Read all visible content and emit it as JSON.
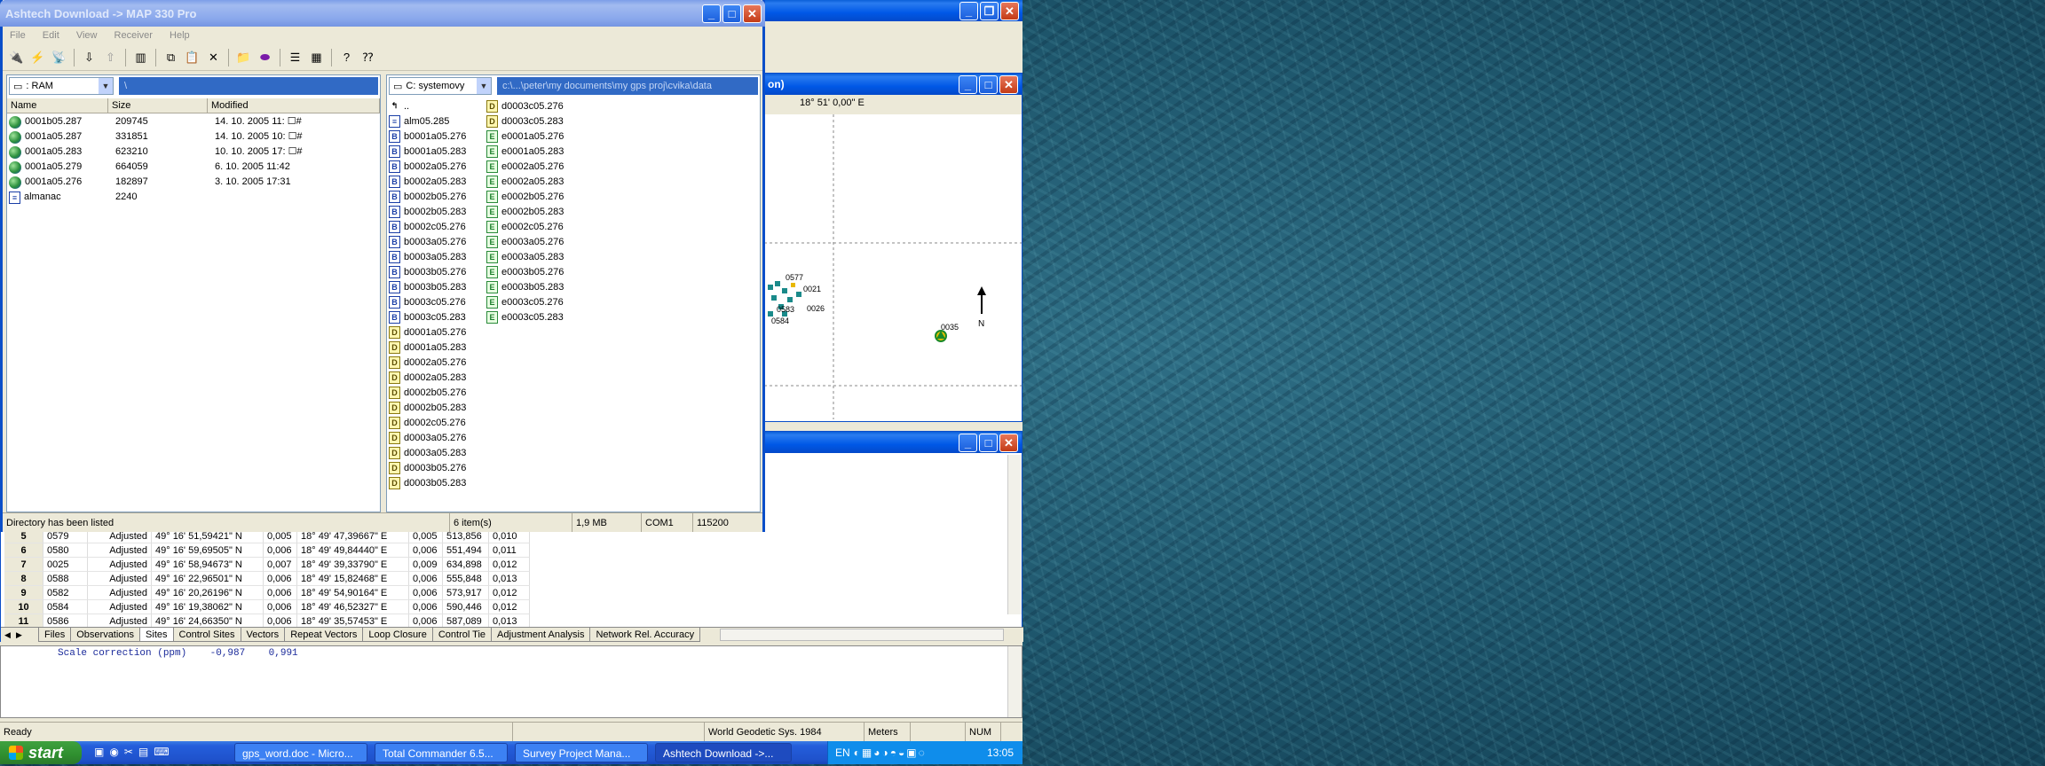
{
  "download_window": {
    "title": "Ashtech Download -> MAP 330 Pro",
    "menu": [
      "File",
      "Edit",
      "View",
      "Receiver",
      "Help"
    ],
    "left_drive": ": RAM",
    "left_path": "\\",
    "left_columns": [
      "Name",
      "Size",
      "Modified"
    ],
    "left_files": [
      {
        "name": "0001b05.287",
        "size": "209745",
        "modified": "14. 10. 2005 11: ☐#"
      },
      {
        "name": "0001a05.287",
        "size": "331851",
        "modified": "14. 10. 2005 10: ☐#"
      },
      {
        "name": "0001a05.283",
        "size": "623210",
        "modified": "10. 10. 2005 17: ☐#"
      },
      {
        "name": "0001a05.279",
        "size": "664059",
        "modified": "6. 10. 2005 11:42"
      },
      {
        "name": "0001a05.276",
        "size": "182897",
        "modified": "3. 10. 2005 17:31"
      },
      {
        "name": "almanac",
        "size": "2240",
        "modified": ""
      }
    ],
    "right_drive": "C: systemovy",
    "right_path": "c:\\...\\peter\\my documents\\my gps proj\\cvika\\data",
    "right_files_col1": [
      {
        "icon": "up",
        "name": ".."
      },
      {
        "icon": "alm",
        "name": "alm05.285"
      },
      {
        "icon": "B",
        "name": "b0001a05.276"
      },
      {
        "icon": "B",
        "name": "b0001a05.283"
      },
      {
        "icon": "B",
        "name": "b0002a05.276"
      },
      {
        "icon": "B",
        "name": "b0002a05.283"
      },
      {
        "icon": "B",
        "name": "b0002b05.276"
      },
      {
        "icon": "B",
        "name": "b0002b05.283"
      },
      {
        "icon": "B",
        "name": "b0002c05.276"
      },
      {
        "icon": "B",
        "name": "b0003a05.276"
      },
      {
        "icon": "B",
        "name": "b0003a05.283"
      },
      {
        "icon": "B",
        "name": "b0003b05.276"
      },
      {
        "icon": "B",
        "name": "b0003b05.283"
      },
      {
        "icon": "B",
        "name": "b0003c05.276"
      },
      {
        "icon": "B",
        "name": "b0003c05.283"
      },
      {
        "icon": "D",
        "name": "d0001a05.276"
      },
      {
        "icon": "D",
        "name": "d0001a05.283"
      },
      {
        "icon": "D",
        "name": "d0002a05.276"
      },
      {
        "icon": "D",
        "name": "d0002a05.283"
      },
      {
        "icon": "D",
        "name": "d0002b05.276"
      },
      {
        "icon": "D",
        "name": "d0002b05.283"
      },
      {
        "icon": "D",
        "name": "d0002c05.276"
      },
      {
        "icon": "D",
        "name": "d0003a05.276"
      },
      {
        "icon": "D",
        "name": "d0003a05.283"
      },
      {
        "icon": "D",
        "name": "d0003b05.276"
      },
      {
        "icon": "D",
        "name": "d0003b05.283"
      }
    ],
    "right_files_col2": [
      {
        "icon": "D",
        "name": "d0003c05.276"
      },
      {
        "icon": "D",
        "name": "d0003c05.283"
      },
      {
        "icon": "E",
        "name": "e0001a05.276"
      },
      {
        "icon": "E",
        "name": "e0001a05.283"
      },
      {
        "icon": "E",
        "name": "e0002a05.276"
      },
      {
        "icon": "E",
        "name": "e0002a05.283"
      },
      {
        "icon": "E",
        "name": "e0002b05.276"
      },
      {
        "icon": "E",
        "name": "e0002b05.283"
      },
      {
        "icon": "E",
        "name": "e0002c05.276"
      },
      {
        "icon": "E",
        "name": "e0003a05.276"
      },
      {
        "icon": "E",
        "name": "e0003a05.283"
      },
      {
        "icon": "E",
        "name": "e0003b05.276"
      },
      {
        "icon": "E",
        "name": "e0003b05.283"
      },
      {
        "icon": "E",
        "name": "e0003c05.276"
      },
      {
        "icon": "E",
        "name": "e0003c05.283"
      }
    ],
    "status": [
      "Directory has been listed",
      "6 item(s)",
      "1,9 MB",
      "COM1",
      "115200"
    ]
  },
  "map_window": {
    "coord_label": "18° 51' 0,00\" E",
    "title_fragment": "on)",
    "points": [
      "0577",
      "0021",
      "0583",
      "0026",
      "0584",
      "0035"
    ],
    "north_label": "N"
  },
  "sites": {
    "rows": [
      {
        "n": "5",
        "id": "0579",
        "status": "Adjusted",
        "lat": "49° 16' 51,59421\" N",
        "e1": "0,005",
        "lon": "18° 49' 47,39667\" E",
        "e2": "0,005",
        "h": "513,856",
        "e3": "0,010"
      },
      {
        "n": "6",
        "id": "0580",
        "status": "Adjusted",
        "lat": "49° 16' 59,69505\" N",
        "e1": "0,006",
        "lon": "18° 49' 49,84440\" E",
        "e2": "0,006",
        "h": "551,494",
        "e3": "0,011"
      },
      {
        "n": "7",
        "id": "0025",
        "status": "Adjusted",
        "lat": "49° 16' 58,94673\" N",
        "e1": "0,007",
        "lon": "18° 49' 39,33790\" E",
        "e2": "0,009",
        "h": "634,898",
        "e3": "0,012"
      },
      {
        "n": "8",
        "id": "0588",
        "status": "Adjusted",
        "lat": "49° 16' 22,96501\" N",
        "e1": "0,006",
        "lon": "18° 49' 15,82468\" E",
        "e2": "0,006",
        "h": "555,848",
        "e3": "0,013"
      },
      {
        "n": "9",
        "id": "0582",
        "status": "Adjusted",
        "lat": "49° 16' 20,26196\" N",
        "e1": "0,006",
        "lon": "18° 49' 54,90164\" E",
        "e2": "0,006",
        "h": "573,917",
        "e3": "0,012"
      },
      {
        "n": "10",
        "id": "0584",
        "status": "Adjusted",
        "lat": "49° 16' 19,38062\" N",
        "e1": "0,006",
        "lon": "18° 49' 46,52327\" E",
        "e2": "0,006",
        "h": "590,446",
        "e3": "0,012"
      },
      {
        "n": "11",
        "id": "0586",
        "status": "Adjusted",
        "lat": "49° 16' 24,66350\" N",
        "e1": "0,006",
        "lon": "18° 49' 35,57453\" E",
        "e2": "0,006",
        "h": "587,089",
        "e3": "0,013"
      }
    ],
    "tabs": [
      "Files",
      "Observations",
      "Sites",
      "Control Sites",
      "Vectors",
      "Repeat Vectors",
      "Loop Closure",
      "Control Tie",
      "Adjustment Analysis",
      "Network Rel. Accuracy"
    ],
    "active_tab": "Sites"
  },
  "output": {
    "text": "Scale correction (ppm)    -0,987    0,991"
  },
  "main_status": {
    "ready": "Ready",
    "datum": "World Geodetic Sys. 1984",
    "units": "Meters",
    "num": "NUM"
  },
  "taskbar": {
    "start": "start",
    "tasks": [
      "gps_word.doc - Micro...",
      "Total Commander 6.5...",
      "Survey Project Mana...",
      "Ashtech Download ->..."
    ],
    "lang": "EN",
    "clock": "13:05"
  }
}
